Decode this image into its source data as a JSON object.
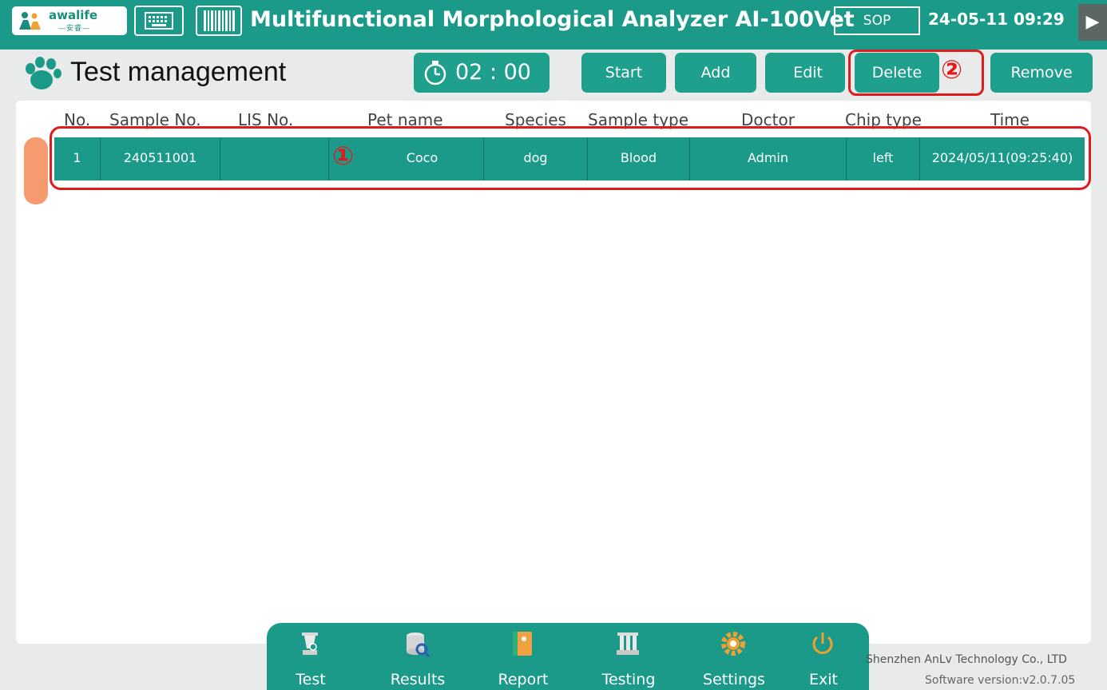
{
  "header": {
    "logo_text": "awalife",
    "logo_subtext": "—安睿—",
    "app_title": "Multifunctional Morphological Analyzer AI-100Vet",
    "sop_label": "SOP",
    "datetime": "24-05-11 09:29",
    "corner_arrow": "▶"
  },
  "page": {
    "title": "Test management"
  },
  "toolbar": {
    "timer": "02 : 00",
    "start_label": "Start",
    "add_label": "Add",
    "edit_label": "Edit",
    "delete_label": "Delete",
    "remove_label": "Remove"
  },
  "annotations": {
    "marker_1": "①",
    "marker_2": "②"
  },
  "table": {
    "columns": [
      "No.",
      "Sample No.",
      "LIS No.",
      "Pet name",
      "Species",
      "Sample type",
      "Doctor",
      "Chip type",
      "Time"
    ],
    "rows": [
      {
        "no": "1",
        "sample_no": "240511001",
        "lis_no": "",
        "pet_name": "Coco",
        "species": "dog",
        "sample_type": "Blood",
        "doctor": "Admin",
        "chip_type": "left",
        "time": "2024/05/11(09:25:40)"
      }
    ]
  },
  "dock": {
    "items": [
      {
        "label": "Test",
        "icon": "test-icon"
      },
      {
        "label": "Results",
        "icon": "results-icon"
      },
      {
        "label": "Report",
        "icon": "report-icon"
      },
      {
        "label": "Testing",
        "icon": "testing-icon"
      },
      {
        "label": "Settings",
        "icon": "settings-icon"
      },
      {
        "label": "Exit",
        "icon": "power-icon"
      }
    ]
  },
  "footer": {
    "company": "Shenzhen AnLv Technology Co., LTD",
    "version": "Software version:v2.0.7.05"
  },
  "colors": {
    "primary_teal": "#1b9a89",
    "highlight_red": "#e01b1b",
    "scroll_orange": "#f69b6f"
  }
}
